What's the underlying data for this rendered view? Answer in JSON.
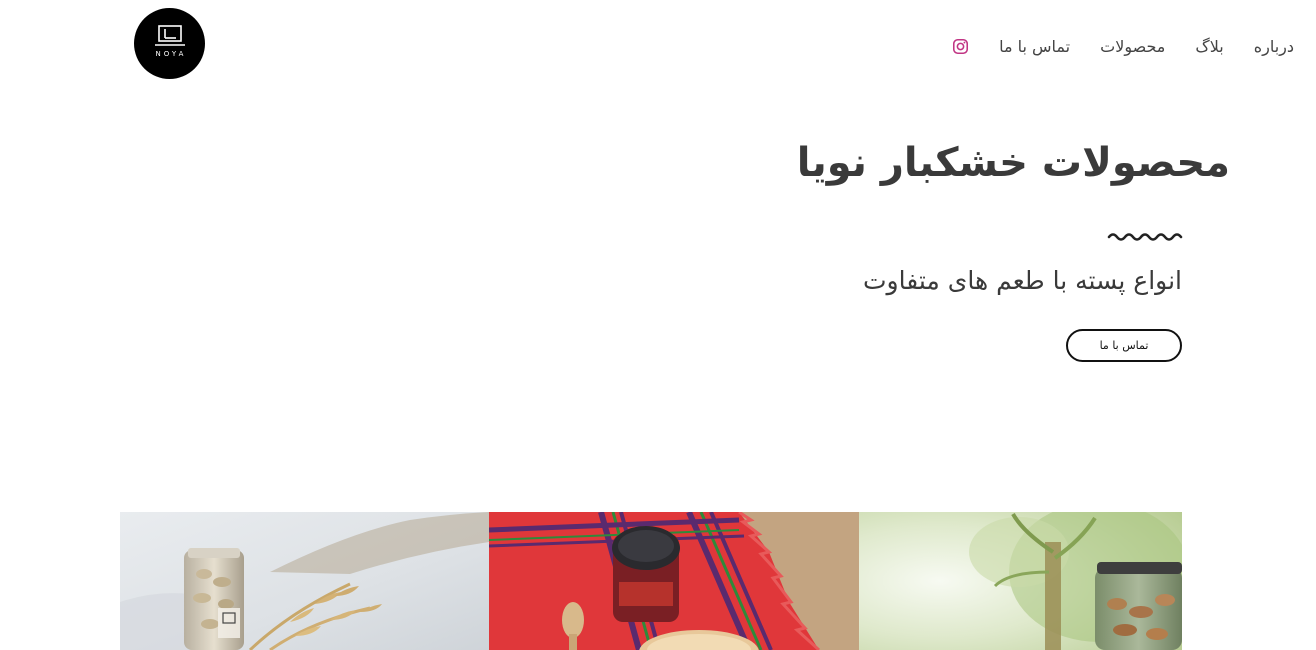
{
  "header": {
    "logo": {
      "text": "NOYA"
    },
    "nav": {
      "instagram_icon": "instagram-icon",
      "items": [
        {
          "label": "تماس با ما"
        },
        {
          "label": "محصولات"
        },
        {
          "label": "بلاگ"
        },
        {
          "label": "درباره"
        }
      ]
    }
  },
  "hero": {
    "title": "محصولات خشکبار نویا",
    "subtitle": "انواع پسته با طعم های متفاوت",
    "cta_label": "تماس با ما"
  },
  "gallery": {
    "photos": [
      {
        "name": "pistachio-jar-wheat-photo"
      },
      {
        "name": "jar-on-red-cloth-photo"
      },
      {
        "name": "jar-greenery-photo"
      }
    ]
  },
  "colors": {
    "text": "#333333",
    "instagram": "#c13584",
    "logo_bg": "#000000",
    "cta_border": "#111111"
  }
}
